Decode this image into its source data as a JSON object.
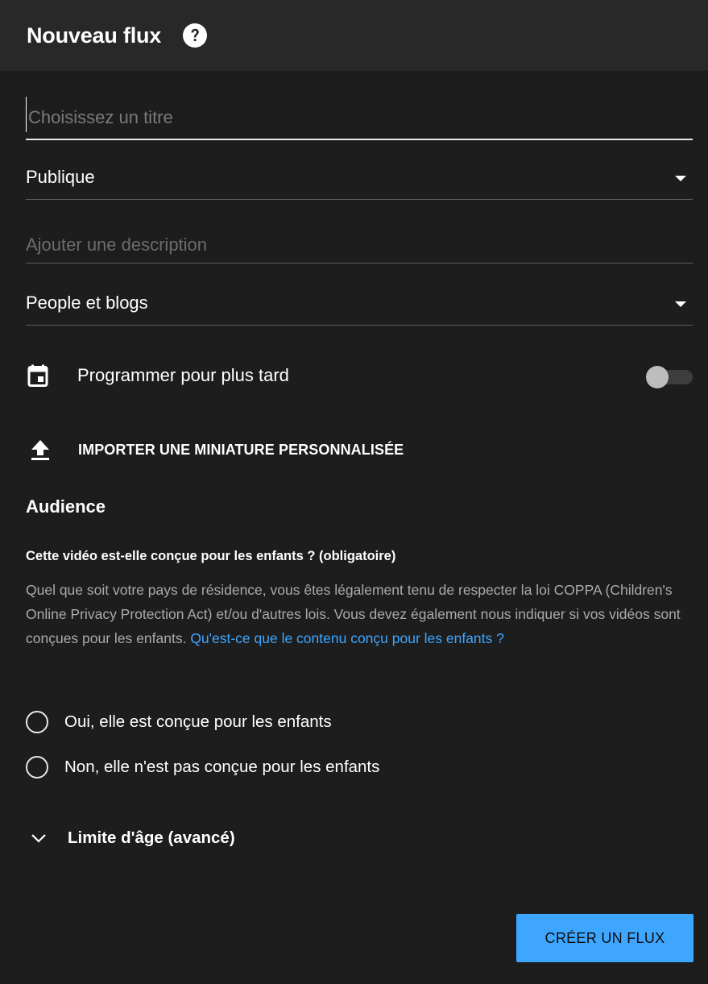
{
  "header": {
    "title": "Nouveau flux",
    "help_icon": "help-circle-icon"
  },
  "form": {
    "title_placeholder": "Choisissez un titre",
    "title_value": "",
    "visibility_value": "Publique",
    "description_placeholder": "Ajouter une description",
    "description_value": "",
    "category_value": "People et blogs",
    "schedule_label": "Programmer pour plus tard",
    "schedule_enabled": false,
    "upload_label": "IMPORTER UNE MINIATURE PERSONNALISÉE"
  },
  "audience": {
    "heading": "Audience",
    "question": "Cette vidéo est-elle conçue pour les enfants ? (obligatoire)",
    "legal_text": "Quel que soit votre pays de résidence, vous êtes légalement tenu de respecter la loi COPPA (Children's Online Privacy Protection Act) et/ou d'autres lois. Vous devez également nous indiquer si vos vidéos sont conçues pour les enfants.",
    "legal_link": "Qu'est-ce que le contenu conçu pour les enfants ?",
    "option_yes": "Oui, elle est conçue pour les enfants",
    "option_no": "Non, elle n'est pas conçue pour les enfants",
    "age_restriction": "Limite d'âge (avancé)"
  },
  "actions": {
    "create_label": "CRÉER UN FLUX"
  },
  "colors": {
    "background": "#1d1d1d",
    "header": "#282828",
    "accent": "#3ea6ff",
    "muted_text": "#aaaaaa"
  }
}
